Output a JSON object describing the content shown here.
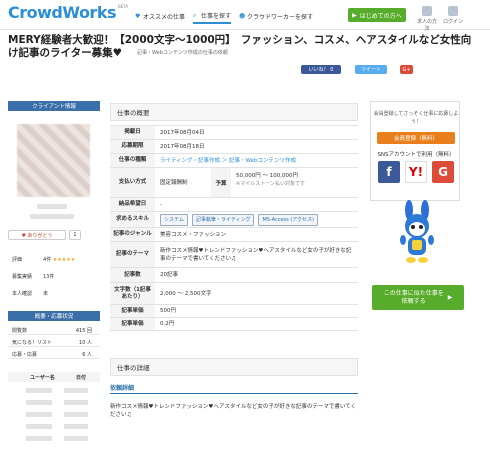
{
  "header": {
    "logo": "CrowdWorks",
    "logo_sub": "BETA",
    "nav": [
      {
        "label": "オススメの仕事",
        "icon": "heart-icon"
      },
      {
        "label": "仕事を探す",
        "icon": "search-icon"
      },
      {
        "label": "クラウドワーカーを探す",
        "icon": "people-icon"
      }
    ],
    "cta_label": "はじめての方へ",
    "icons": [
      {
        "label": "求人の方法",
        "icon": "document-icon"
      },
      {
        "label": "ログイン",
        "icon": "login-icon"
      }
    ]
  },
  "job": {
    "title": "MERY経験者大歓迎！【2000文字〜1000円】　ファッション、コスメ、ヘアスタイルなど女性向け記事のライター募集♥",
    "breadcrumb": "記事・Webコンテンツ作成の仕事の依頼",
    "share": {
      "like": "いいね！ 0",
      "tweet": "ツイート",
      "gplus": "G+"
    }
  },
  "client": {
    "header": "クライアント情報",
    "thanks_label": "♥ ありがとう",
    "thanks_count": "1",
    "rating_label": "評価",
    "rating_value": "4件",
    "stars": "★★★★★",
    "contract_label": "募集実績",
    "contract_value": "13件",
    "verify_label": "本人確認",
    "verify_value": "未",
    "stats_header": "概要・応募状況",
    "stats": [
      {
        "label": "閲覧数",
        "value": "415 回"
      },
      {
        "label": "気になる！リスト",
        "value": "10 人"
      },
      {
        "label": "応募・応募",
        "value": "6 人"
      }
    ],
    "user_table_headers": [
      "ユーザー名",
      "日付"
    ]
  },
  "overview": {
    "title": "仕事の概要",
    "rows": [
      {
        "k": "掲載日",
        "v": "2017年08月04日"
      },
      {
        "k": "応募期限",
        "v": "2017年08月18日"
      },
      {
        "k": "仕事の種類",
        "v": "ライティング・記事作成 ＞ 記事・Webコンテンツ作成"
      },
      {
        "k": "支払い方式",
        "v": "固定報酬制"
      },
      {
        "k": "納品希望日",
        "v": "-"
      },
      {
        "k": "求めるスキル",
        "v": ""
      },
      {
        "k": "記事のジャンル",
        "v": "美容コスメ・ファッション"
      },
      {
        "k": "記事のテーマ",
        "v": "新作コスメ情報♥トレンドファッション♥ヘアスタイルなど女の子が好きな記事のテーマで書いてください♫"
      },
      {
        "k": "記事数",
        "v": "20記事"
      },
      {
        "k": "文字数（1記事あたり）",
        "v": "2,000 〜 2,500文字"
      },
      {
        "k": "記事単価",
        "v": "500円"
      },
      {
        "k": "記事単価",
        "v": "0.2円"
      }
    ],
    "pay_sub_label": "予算",
    "pay_sub_value": "50,000円 〜 100,000円",
    "pay_sub_note": "※マイルストーン払い対象です",
    "skills": [
      "システム",
      "記事執筆・ライティング",
      "MS-Access (アクセス)"
    ]
  },
  "detail": {
    "title": "仕事の詳細",
    "subhead": "依頼詳細",
    "text": "新作コスメ情報♥トレンドファッション♥ヘアスタイルなど女の子が好きな記事のテーマで書いてください♫"
  },
  "sidebar_right": {
    "reg_text": "会員登録してさっそく仕事に応募しよう！",
    "reg_button": "会員登録（無料）",
    "sns_label": "SNSアカウントで利用（無料）",
    "sns": [
      "f",
      "Y!",
      "G"
    ],
    "similar_button": "この仕事に似た仕事を依頼する"
  },
  "colors": {
    "brand": "#2c8fd6",
    "green": "#57ad2b",
    "orange": "#e97f1c",
    "navy": "#3b6fa9"
  }
}
